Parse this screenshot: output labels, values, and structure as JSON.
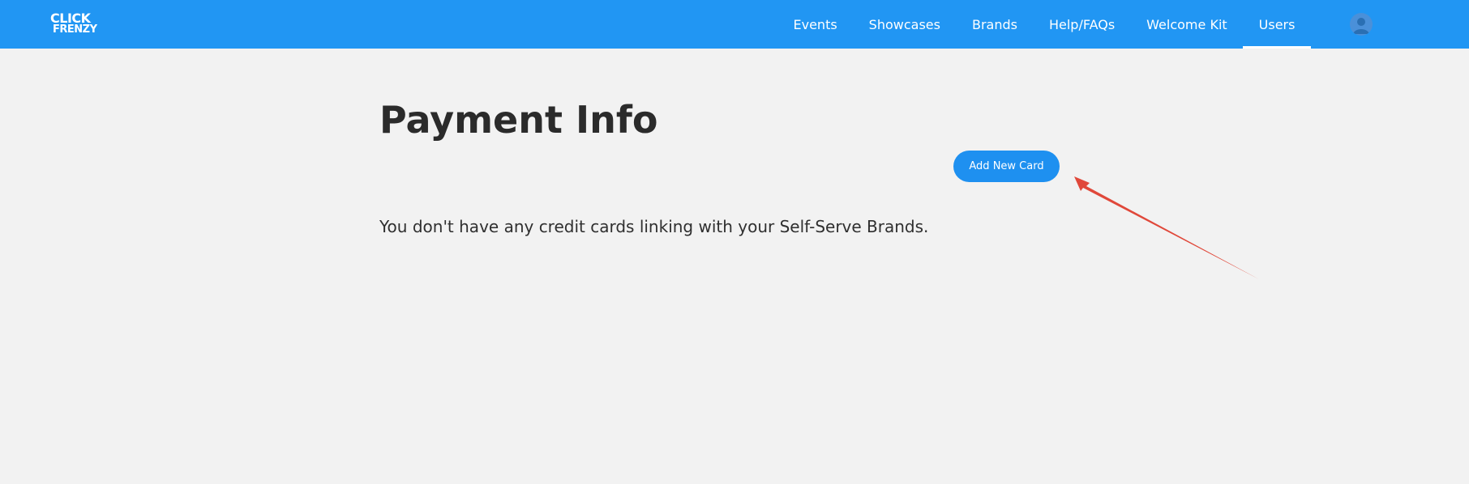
{
  "header": {
    "logo_line1": "CLICK",
    "logo_line2": "FRENZY",
    "nav": [
      {
        "label": "Events"
      },
      {
        "label": "Showcases"
      },
      {
        "label": "Brands"
      },
      {
        "label": "Help/FAQs"
      },
      {
        "label": "Welcome Kit"
      },
      {
        "label": "Users",
        "active": true
      }
    ],
    "avatar_icon": "user-avatar-icon"
  },
  "main": {
    "title": "Payment Info",
    "add_card_label": "Add New Card",
    "empty_message": "You don't have any credit cards linking with your Self-Serve Brands."
  },
  "colors": {
    "header_bg": "#2196f3",
    "page_bg": "#f2f2f2",
    "button_bg": "#1e90f0",
    "annotation": "#e0483a"
  }
}
